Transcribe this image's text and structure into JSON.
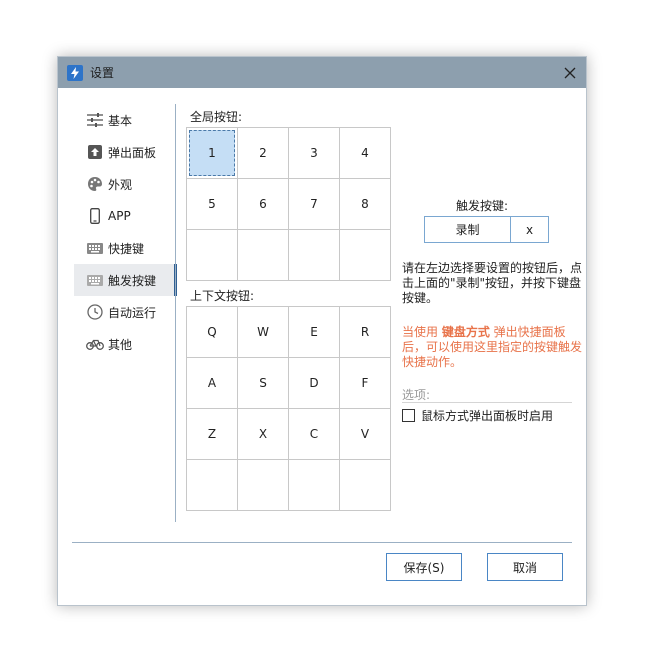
{
  "window": {
    "title": "设置"
  },
  "sidebar": {
    "items": [
      {
        "label": "基本",
        "icon": "sliders-icon"
      },
      {
        "label": "弹出面板",
        "icon": "upload-icon"
      },
      {
        "label": "外观",
        "icon": "palette-icon"
      },
      {
        "label": "APP",
        "icon": "phone-icon"
      },
      {
        "label": "快捷键",
        "icon": "keyboard-icon"
      },
      {
        "label": "触发按键",
        "icon": "keyboard-icon",
        "active": true
      },
      {
        "label": "自动运行",
        "icon": "clock-icon"
      },
      {
        "label": "其他",
        "icon": "bicycle-icon"
      }
    ]
  },
  "global_section": {
    "label": "全局按钮:",
    "cells": [
      "1",
      "2",
      "3",
      "4",
      "5",
      "6",
      "7",
      "8",
      "",
      "",
      "",
      ""
    ],
    "selected_index": 0
  },
  "context_section": {
    "label": "上下文按钮:",
    "cells": [
      "Q",
      "W",
      "E",
      "R",
      "A",
      "S",
      "D",
      "F",
      "Z",
      "X",
      "C",
      "V",
      "",
      "",
      "",
      ""
    ]
  },
  "trigger": {
    "label": "触发按键:",
    "record_label": "录制",
    "key_value": "x"
  },
  "hint_text": "请在左边选择要设置的按钮后，点击上面的\"录制\"按钮，并按下键盘按键。",
  "warning": {
    "prefix": "当使用 ",
    "emphasis": "键盘方式",
    "suffix": " 弹出快捷面板后，可以使用这里指定的按键触发快捷动作。"
  },
  "options": {
    "label": "选项:",
    "checkbox_label": "鼠标方式弹出面板时启用",
    "checked": false
  },
  "buttons": {
    "save_label": "保存(S)",
    "cancel_label": "取消"
  },
  "colors": {
    "titlebar": "#8d9fae",
    "accent": "#2f5f93",
    "warning_text": "#e8734a",
    "selected_cell": "#c5def5"
  }
}
